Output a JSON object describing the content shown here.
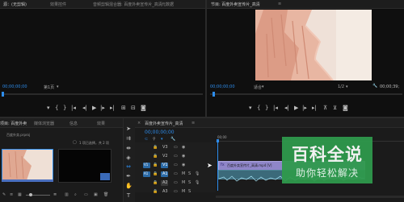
{
  "source_monitor": {
    "tab_source": "源：(无剪辑)",
    "tab_effects": "效果控件",
    "tab_audio_mixer": "音频剪辑混合器: 百度外卖宣传片_高清",
    "tab_metadata": "元数据",
    "timecode": "00;00;00;00",
    "page": "第1页"
  },
  "program_monitor": {
    "tab_program": "节目: 百度外卖宣传片_高清",
    "timecode": "00;00;00;00",
    "fit": "适合",
    "quality": "1/2",
    "end_timecode": "00;00;39;"
  },
  "project_panel": {
    "tab_project": "项目: 百度外卖",
    "tab_media_browser": "媒体浏览器",
    "tab_info": "信息",
    "tab_effects": "效果",
    "file_label": "百度外卖.prproj",
    "selected_info": "1 项已选择，共 2 项"
  },
  "timeline": {
    "tab_title": "百度外卖宣传片_高清",
    "timecode": "00;00;00;00",
    "ruler_label": "00;00",
    "tracks": [
      {
        "name": "V3"
      },
      {
        "name": "V2"
      },
      {
        "name": "V1",
        "target": "V1"
      },
      {
        "name": "A1",
        "target": "A1"
      },
      {
        "name": "A2"
      },
      {
        "name": "A3"
      }
    ],
    "clip_label": "百度外卖宣传片_高清.mp4 [V]"
  },
  "watermark": {
    "title": "百科全说",
    "subtitle": "助你轻松解决"
  },
  "colors": {
    "accent_blue": "#2d8ceb",
    "clip_purple": "#8f86c9",
    "watermark_green": "#2f9a4c"
  }
}
